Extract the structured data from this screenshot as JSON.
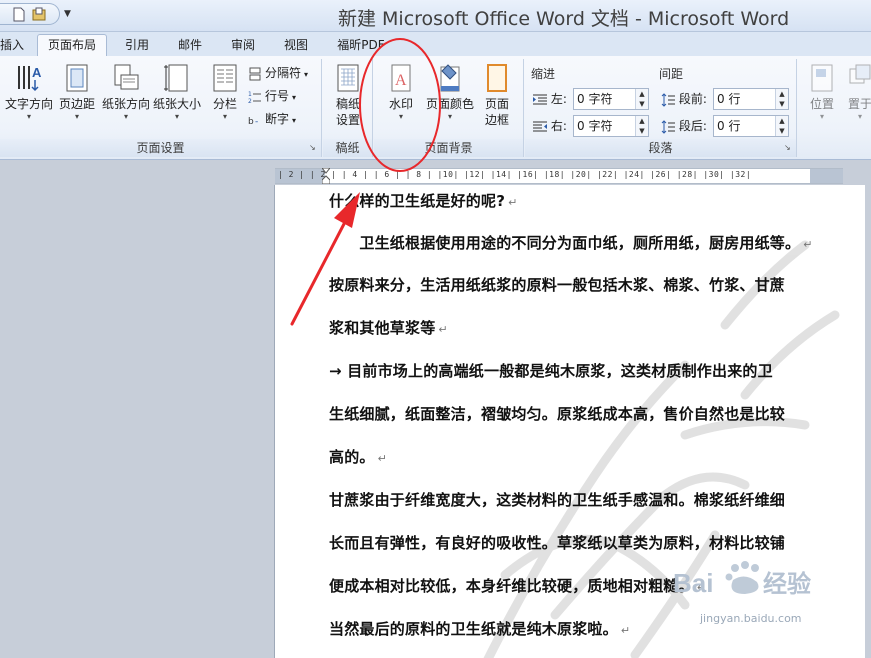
{
  "window": {
    "title": "新建 Microsoft Office Word 文档 - Microsoft Word"
  },
  "tabs": [
    {
      "label": "插入"
    },
    {
      "label": "页面布局"
    },
    {
      "label": "引用"
    },
    {
      "label": "邮件"
    },
    {
      "label": "审阅"
    },
    {
      "label": "视图"
    },
    {
      "label": "福昕PDF"
    }
  ],
  "ribbon": {
    "page_setup": {
      "label": "页面设置",
      "text_direction": "文字方向",
      "margins": "页边距",
      "orientation": "纸张方向",
      "size": "纸张大小",
      "columns": "分栏",
      "breaks": "分隔符",
      "line_numbers": "行号",
      "hyphenation": "断字"
    },
    "paper": {
      "label": "稿纸",
      "settings_line1": "稿纸",
      "settings_line2": "设置"
    },
    "page_background": {
      "label": "页面背景",
      "watermark": "水印",
      "page_color": "页面颜色",
      "page_borders_line1": "页面",
      "page_borders_line2": "边框"
    },
    "paragraph": {
      "label": "段落",
      "indent_title": "缩进",
      "spacing_title": "间距",
      "indent_left_label": "左:",
      "indent_left_value": "0 字符",
      "indent_right_label": "右:",
      "indent_right_value": "0 字符",
      "space_before_label": "段前:",
      "space_before_value": "0 行",
      "space_after_label": "段后:",
      "space_after_value": "0 行"
    },
    "arrange": {
      "position": "位置",
      "wrap": "置于"
    }
  },
  "ruler": {
    "text": "| 2 |  | 2 |  | 4 |  | 6 |  | 8 |  |10|  |12|  |14|  |16|  |18|  |20|  |22|  |24|  |26|  |28|  |30|  |32|"
  },
  "document": {
    "lines": [
      "什么样的卫生纸是好的呢?",
      "　　卫生纸根据使用用途的不同分为面巾纸，厕所用纸，厨房用纸等。",
      "按原料来分，生活用纸纸浆的原料一般包括木浆、棉浆、竹浆、甘蔗",
      "浆和其他草浆等",
      "→ 目前市场上的高端纸一般都是纯木原浆，这类材质制作出来的卫",
      "生纸细腻，纸面整洁，褶皱均匀。原浆纸成本高，售价自然也是比较",
      "高的。",
      "甘蔗浆由于纤维宽度大，这类材料的卫生纸手感温和。棉浆纸纤维细",
      "长而且有弹性，有良好的吸收性。草浆纸以草类为原料，材料比较铺",
      "便成本相对比较低，本身纤维比较硬，质地相对粗糙。",
      "当然最后的原料的卫生纸就是纯木原浆啦。"
    ],
    "paragraph_mark": "↵"
  },
  "watermark_brand": {
    "logo": "Bai du 经验",
    "url": "jingyan.baidu.com"
  },
  "colors": {
    "annotation_red": "#e8282b",
    "ribbon_border": "#a9bbd5"
  }
}
